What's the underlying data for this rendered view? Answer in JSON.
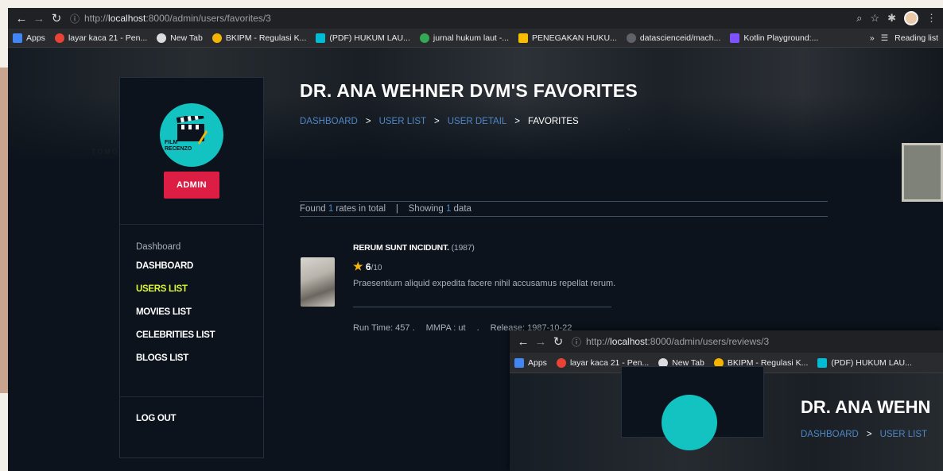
{
  "browser": {
    "url_prefix": "http://",
    "url_host": "localhost",
    "url_rest": ":8000/admin/users/favorites/3",
    "bookmarks": [
      {
        "label": "Apps",
        "color": "#4285f4"
      },
      {
        "label": "layar kaca 21 - Pen...",
        "color": "#ea4335"
      },
      {
        "label": "New Tab",
        "color": "#dadce0"
      },
      {
        "label": "BKIPM - Regulasi K...",
        "color": "#f4b400"
      },
      {
        "label": "(PDF) HUKUM LAU...",
        "color": "#00bcd4"
      },
      {
        "label": "jurnal hukum laut -...",
        "color": "#34a853"
      },
      {
        "label": "PENEGAKAN HUKU...",
        "color": "#fbbc04"
      },
      {
        "label": "datascienceid/mach...",
        "color": "#5f6368"
      },
      {
        "label": "Kotlin Playground:...",
        "color": "#7f52ff"
      }
    ],
    "more": "»",
    "reading_list": "Reading list"
  },
  "sidebar": {
    "admin_button": "ADMIN",
    "logo_text": "FILM RECENZO",
    "caption": "Dashboard",
    "items": [
      {
        "label": "DASHBOARD",
        "active": false
      },
      {
        "label": "USERS LIST",
        "active": true
      },
      {
        "label": "MOVIES LIST",
        "active": false
      },
      {
        "label": "CELEBRITIES LIST",
        "active": false
      },
      {
        "label": "BLOGS LIST",
        "active": false
      }
    ],
    "logout": "LOG OUT"
  },
  "main": {
    "title": "DR. ANA WEHNER DVM'S FAVORITES",
    "breadcrumbs": [
      "DASHBOARD",
      "USER LIST",
      "USER DETAIL",
      "FAVORITES"
    ],
    "breadcrumb_sep": ">",
    "summary": {
      "found_prefix": "Found ",
      "found_count": "1",
      "found_suffix": " rates in total",
      "divider": "|",
      "showing_prefix": "Showing ",
      "showing_count": "1",
      "showing_suffix": " data"
    },
    "movie": {
      "title": "RERUM SUNT INCIDUNT.",
      "year": "(1987)",
      "rating": "6",
      "rating_max": "/10",
      "description": "Praesentium aliquid expedita facere nihil accusamus repellat rerum.",
      "run_time": "Run Time: 457 .",
      "mmpa": "MMPA : ut",
      "dot": ".",
      "release": "Release: 1987-10-22"
    }
  },
  "second_window": {
    "url_prefix": "http://",
    "url_host": "localhost",
    "url_rest": ":8000/admin/users/reviews/3",
    "bookmarks": [
      "Apps",
      "layar kaca 21 - Pen...",
      "New Tab",
      "BKIPM - Regulasi K...",
      "(PDF) HUKUM LAU..."
    ],
    "title": "DR. ANA WEHN",
    "breadcrumbs": [
      "DASHBOARD",
      "USER LIST"
    ],
    "breadcrumb_sep": ">"
  },
  "colors": {
    "accent_active": "#dcf836",
    "admin_red": "#dc1e44",
    "link_blue": "#4f86c6",
    "logo_teal": "#12c3c2"
  }
}
